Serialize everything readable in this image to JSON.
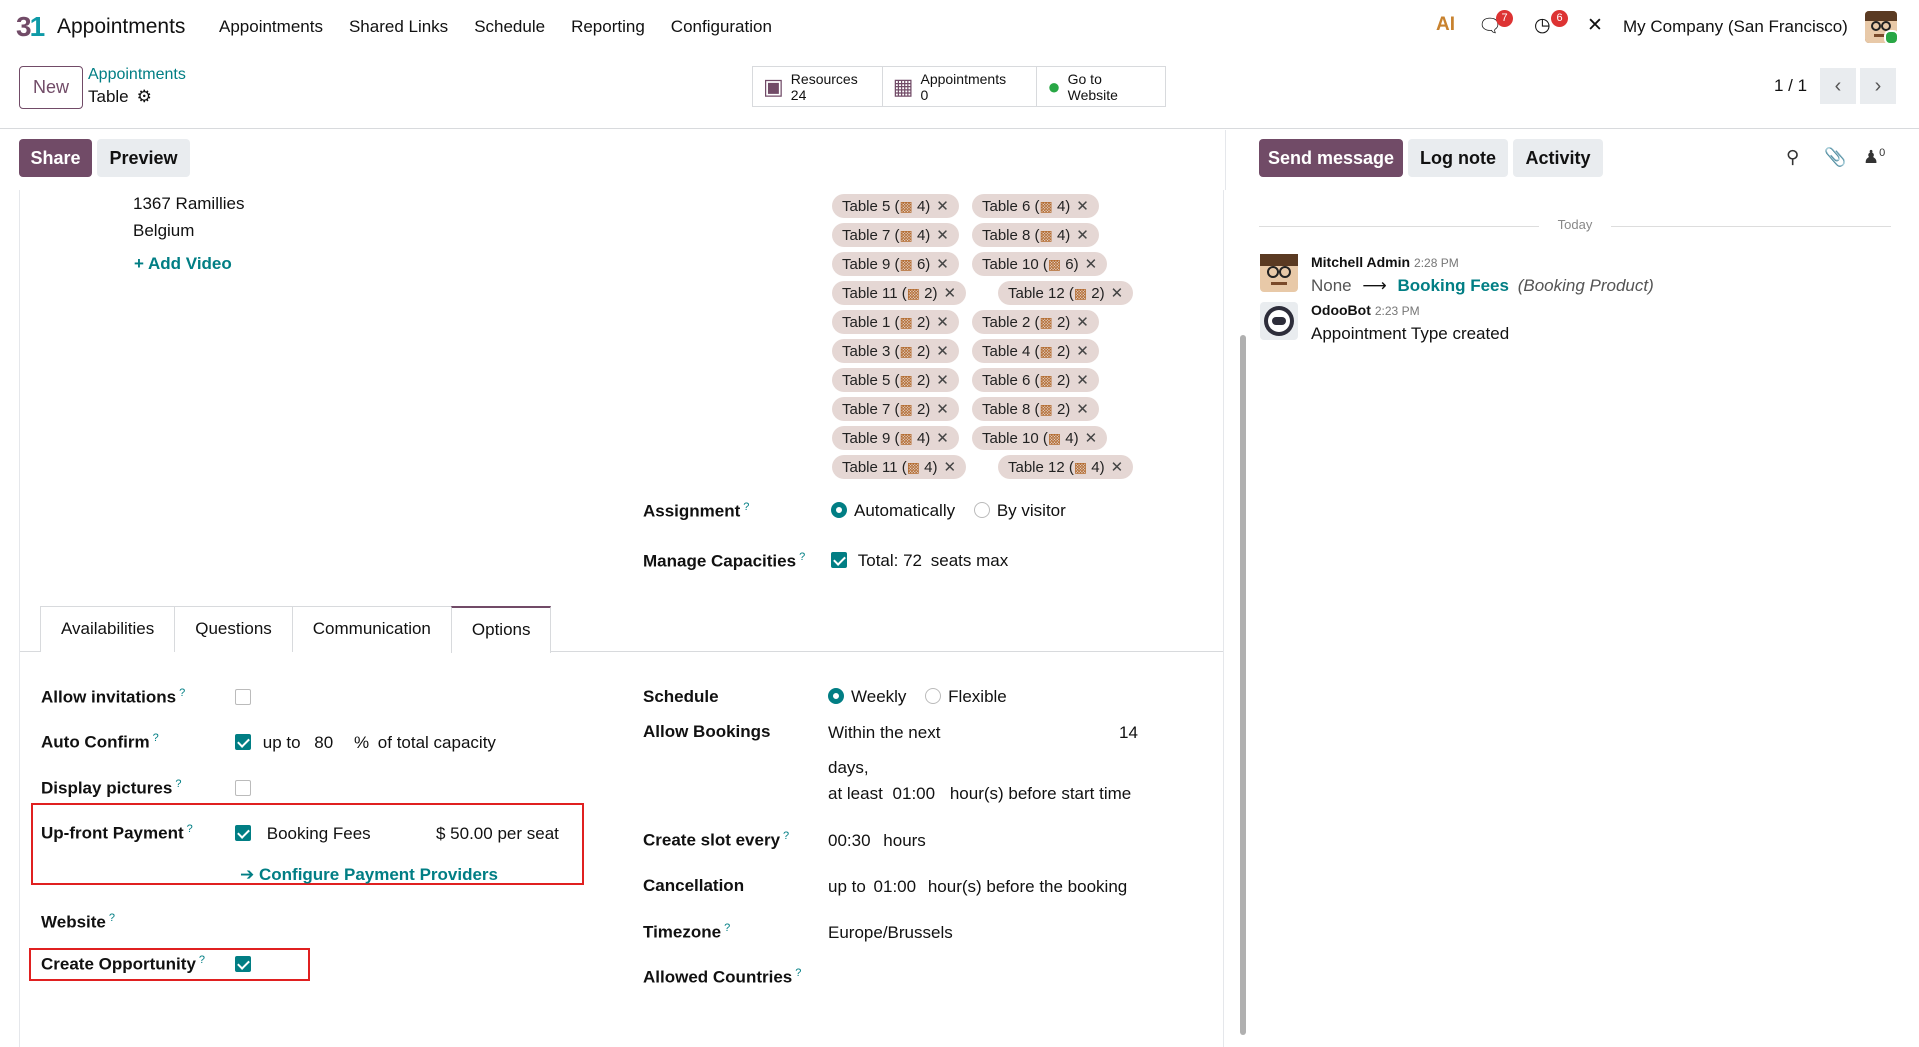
{
  "app": {
    "name": "Appointments"
  },
  "menu": [
    "Appointments",
    "Shared Links",
    "Schedule",
    "Reporting",
    "Configuration"
  ],
  "systray": {
    "ai_label": "AI",
    "messages_count": "7",
    "activities_count": "6",
    "company": "My Company (San Francisco)"
  },
  "control": {
    "new_label": "New",
    "breadcrumb_parent": "Appointments",
    "breadcrumb_current": "Table",
    "stat_resources_label": "Resources",
    "stat_resources_value": "24",
    "stat_appointments_label": "Appointments",
    "stat_appointments_value": "0",
    "stat_website_label1": "Go to",
    "stat_website_label2": "Website",
    "pager": "1 / 1"
  },
  "form_buttons": {
    "share": "Share",
    "preview": "Preview"
  },
  "address": {
    "line1": "1367 Ramillies",
    "line2": "Belgium",
    "add_video": "+ Add Video"
  },
  "resources": [
    {
      "name": "Table 5 (",
      "cap": "4)"
    },
    {
      "name": "Table 6 (",
      "cap": "4)"
    },
    {
      "name": "Table 7 (",
      "cap": "4)"
    },
    {
      "name": "Table 8 (",
      "cap": "4)"
    },
    {
      "name": "Table 9 (",
      "cap": "6)"
    },
    {
      "name": "Table 10 (",
      "cap": "6)"
    },
    {
      "name": "Table 11 (",
      "cap": "2)"
    },
    {
      "name": "Table 12 (",
      "cap": "2)"
    },
    {
      "name": "Table 1 (",
      "cap": "2)"
    },
    {
      "name": "Table 2 (",
      "cap": "2)"
    },
    {
      "name": "Table 3 (",
      "cap": "2)"
    },
    {
      "name": "Table 4 (",
      "cap": "2)"
    },
    {
      "name": "Table 5 (",
      "cap": "2)"
    },
    {
      "name": "Table 6 (",
      "cap": "2)"
    },
    {
      "name": "Table 7 (",
      "cap": "2)"
    },
    {
      "name": "Table 8 (",
      "cap": "2)"
    },
    {
      "name": "Table 9 (",
      "cap": "4)"
    },
    {
      "name": "Table 10 (",
      "cap": "4)"
    },
    {
      "name": "Table 11 (",
      "cap": "4)"
    },
    {
      "name": "Table 12 (",
      "cap": "4)"
    }
  ],
  "assignment": {
    "label": "Assignment",
    "opt_auto": "Automatically",
    "opt_visitor": "By visitor"
  },
  "capacities": {
    "label": "Manage Capacities",
    "total": "Total: 72",
    "seats": "seats max"
  },
  "tabs": [
    "Availabilities",
    "Questions",
    "Communication",
    "Options"
  ],
  "options": {
    "allow_invitations": "Allow invitations",
    "auto_confirm": "Auto Confirm",
    "auto_confirm_upto": "up to",
    "auto_confirm_value": "80",
    "auto_confirm_pct": "%",
    "auto_confirm_suffix": "of total capacity",
    "display_pictures": "Display pictures",
    "upfront_payment": "Up-front Payment",
    "booking_fees": "Booking Fees",
    "price": "$ 50.00 per seat",
    "configure_providers": "Configure Payment Providers",
    "website": "Website",
    "create_opportunity": "Create Opportunity",
    "schedule": "Schedule",
    "schedule_weekly": "Weekly",
    "schedule_flexible": "Flexible",
    "allow_bookings": "Allow Bookings",
    "within_next": "Within the next",
    "within_value": "14",
    "days": "days,",
    "at_least": "at least",
    "at_least_value": "01:00",
    "before_start": "hour(s) before start time",
    "slot_every": "Create slot every",
    "slot_value": "00:30",
    "slot_unit": "hours",
    "cancellation": "Cancellation",
    "cancel_upto": "up to",
    "cancel_value": "01:00",
    "cancel_suffix": "hour(s) before the booking",
    "timezone": "Timezone",
    "timezone_value": "Europe/Brussels",
    "allowed_countries": "Allowed Countries"
  },
  "chatter": {
    "send_message": "Send message",
    "log_note": "Log note",
    "activity": "Activity",
    "followers_count": "0",
    "today": "Today",
    "messages": [
      {
        "author": "Mitchell Admin",
        "time": "2:28 PM",
        "from": "None",
        "to": "Booking Fees",
        "field": "(Booking Product)"
      },
      {
        "author": "OdooBot",
        "time": "2:23 PM",
        "body": "Appointment Type created"
      }
    ]
  },
  "colors": {
    "primary": "#714b67",
    "accent": "#017e84",
    "highlight": "#e02020"
  }
}
